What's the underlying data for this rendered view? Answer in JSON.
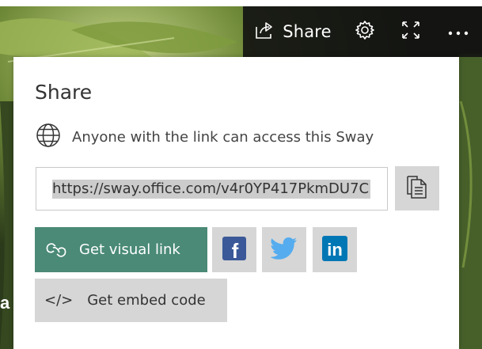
{
  "toolbar": {
    "share_label": "Share",
    "icons": [
      "share-icon",
      "settings-icon",
      "fullscreen-icon",
      "more-icon"
    ],
    "more_label": "···"
  },
  "share_panel": {
    "title": "Share",
    "access_text": "Anyone with the link can access this Sway",
    "access_icon": "globe-icon",
    "link_value": "https://sway.office.com/v4r0YP417PkmDU7C",
    "copy_icon": "copy-icon",
    "visual_link_label": "Get visual link",
    "visual_link_icon": "link-icon",
    "social": {
      "facebook": "f",
      "twitter_icon": "twitter-icon",
      "linkedin": "in"
    },
    "embed_code_glyph": "</>",
    "embed_label": "Get embed code"
  },
  "background": {
    "edge_text": "a"
  },
  "colors": {
    "accent_green": "#4a8a76",
    "facebook_blue": "#3b5998",
    "twitter_blue": "#55acee",
    "linkedin_blue": "#0077b5",
    "button_gray": "#d6d6d6",
    "toolbar_dark": "#121212"
  }
}
